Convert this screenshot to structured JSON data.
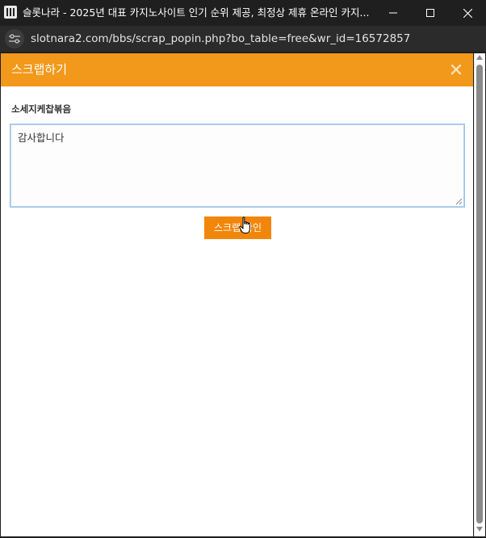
{
  "window": {
    "title": "슬롯나라 - 2025년 대표 카지노사이트 인기 순위 제공, 최정상 제휴 온라인 카지...",
    "url": "slotnara2.com/bbs/scrap_popin.php?bo_table=free&wr_id=16572857"
  },
  "popup": {
    "title": "스크랩하기",
    "field_label": "소세지케찹볶음",
    "comment_value": "감사합니다",
    "submit_label": "스크랩 확인"
  },
  "icons": {
    "app": "app-icon",
    "minimize": "minimize-icon",
    "maximize": "maximize-icon",
    "close": "close-icon",
    "site_settings": "site-settings-icon",
    "popup_close": "close-icon",
    "cursor": "hand-pointer-icon"
  },
  "colors": {
    "header": "#f2981a",
    "button": "#f2860a",
    "titlebar": "#1f1f1f",
    "addressbar": "#2b2b2b"
  }
}
